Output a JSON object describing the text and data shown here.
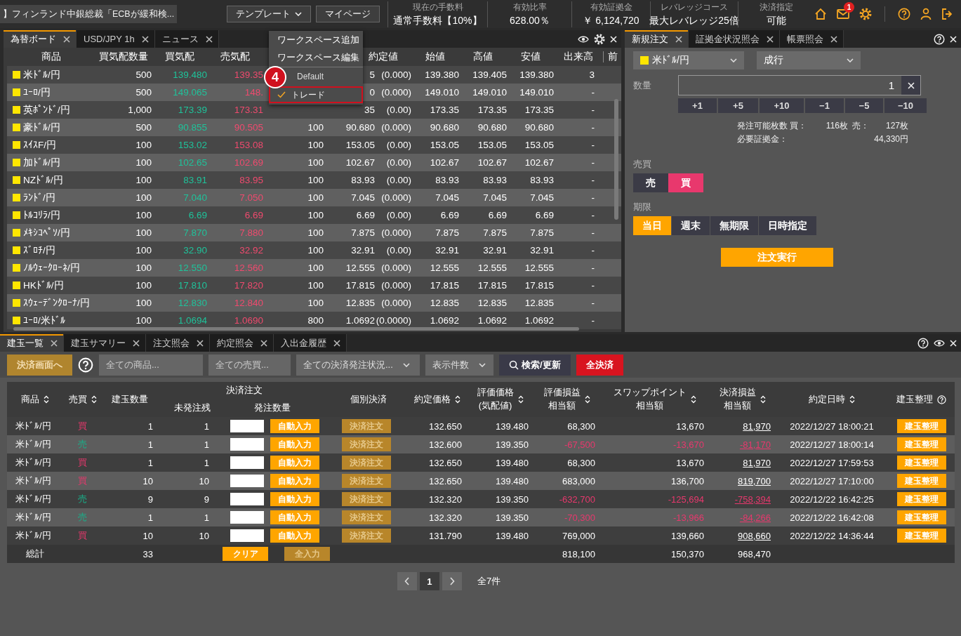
{
  "top_bar": {
    "news": "】フィンランド中銀総裁「ECBが緩和検...",
    "buttons": [
      {
        "label": "テンプレート",
        "dropdown": true
      },
      {
        "label": "マイページ",
        "dropdown": false
      }
    ],
    "stats": [
      {
        "label": "現在の手数料",
        "value": "通常手数料【10%】"
      },
      {
        "label": "有効比率",
        "value": "628.00％"
      },
      {
        "label": "有効証拠金",
        "value": "￥ 6,124,720"
      },
      {
        "label": "レバレッジコース",
        "value": "最大レバレッジ25倍"
      },
      {
        "label": "決済指定",
        "value": "可能"
      }
    ],
    "notification_count": "1"
  },
  "workspace_menu": {
    "items": [
      {
        "kind": "action",
        "label": "ワークスペース追加"
      },
      {
        "kind": "action",
        "label": "ワークスペース編集"
      },
      {
        "kind": "workspace",
        "label": "Default",
        "selected": false,
        "highlighted": false
      },
      {
        "kind": "workspace",
        "label": "トレード",
        "selected": true,
        "highlighted": true
      }
    ],
    "step_marker": "4"
  },
  "rate_board": {
    "tabs": [
      {
        "label": "為替ボード",
        "selected": true
      },
      {
        "label": "USD/JPY 1h",
        "selected": false
      },
      {
        "label": "ニュース",
        "selected": false
      }
    ],
    "columns": [
      "商品",
      "買気配数量",
      "買気配",
      "売気配",
      "約定値",
      "始値",
      "高値",
      "安値",
      "出来高",
      "前"
    ],
    "rows": [
      {
        "product": "米ﾄﾞﾙ/円",
        "bid_qty": "500",
        "bid": "139.480",
        "ask": "139.35",
        "last": "5",
        "change": "(0.000)",
        "open": "139.380",
        "high": "139.405",
        "low": "139.380",
        "volume": "3"
      },
      {
        "product": "ﾕｰﾛ/円",
        "bid_qty": "500",
        "bid": "149.065",
        "ask": "148.",
        "last": "0",
        "change": "(0.000)",
        "open": "149.010",
        "high": "149.010",
        "low": "149.010",
        "volume": "-"
      },
      {
        "product": "英ﾎﾟﾝﾄﾞ/円",
        "bid_qty": "1,000",
        "bid": "173.39",
        "ask": "173.31",
        "last": "35",
        "change": "(0.00)",
        "open": "173.35",
        "high": "173.35",
        "low": "173.35",
        "volume": "-"
      },
      {
        "product": "豪ﾄﾞﾙ/円",
        "bid_qty": "500",
        "bid": "90.855",
        "ask": "90.505",
        "column_5": "100",
        "last": "90.680",
        "change": "(0.000)",
        "open": "90.680",
        "high": "90.680",
        "low": "90.680",
        "volume": "-"
      },
      {
        "product": "ｽｲｽF/円",
        "bid_qty": "100",
        "bid": "153.02",
        "ask": "153.08",
        "column_5": "100",
        "last": "153.05",
        "change": "(0.00)",
        "open": "153.05",
        "high": "153.05",
        "low": "153.05",
        "volume": "-"
      },
      {
        "product": "加ﾄﾞﾙ/円",
        "bid_qty": "100",
        "bid": "102.65",
        "ask": "102.69",
        "column_5": "100",
        "last": "102.67",
        "change": "(0.00)",
        "open": "102.67",
        "high": "102.67",
        "low": "102.67",
        "volume": "-"
      },
      {
        "product": "NZﾄﾞﾙ/円",
        "bid_qty": "100",
        "bid": "83.91",
        "ask": "83.95",
        "column_5": "100",
        "last": "83.93",
        "change": "(0.00)",
        "open": "83.93",
        "high": "83.93",
        "low": "83.93",
        "volume": "-"
      },
      {
        "product": "ﾗﾝﾄﾞ/円",
        "bid_qty": "100",
        "bid": "7.040",
        "ask": "7.050",
        "column_5": "100",
        "last": "7.045",
        "change": "(0.000)",
        "open": "7.045",
        "high": "7.045",
        "low": "7.045",
        "volume": "-"
      },
      {
        "product": "ﾄﾙｺﾘﾗ/円",
        "bid_qty": "100",
        "bid": "6.69",
        "ask": "6.69",
        "column_5": "100",
        "last": "6.69",
        "change": "(0.00)",
        "open": "6.69",
        "high": "6.69",
        "low": "6.69",
        "volume": "-"
      },
      {
        "product": "ﾒｷｼｺﾍﾟｿ/円",
        "bid_qty": "100",
        "bid": "7.870",
        "ask": "7.880",
        "column_5": "100",
        "last": "7.875",
        "change": "(0.000)",
        "open": "7.875",
        "high": "7.875",
        "low": "7.875",
        "volume": "-"
      },
      {
        "product": "ｽﾞﾛﾁ/円",
        "bid_qty": "100",
        "bid": "32.90",
        "ask": "32.92",
        "column_5": "100",
        "last": "32.91",
        "change": "(0.00)",
        "open": "32.91",
        "high": "32.91",
        "low": "32.91",
        "volume": "-"
      },
      {
        "product": "ﾉﾙｳｪｰｸﾛｰﾈ/円",
        "bid_qty": "100",
        "bid": "12.550",
        "ask": "12.560",
        "column_5": "100",
        "last": "12.555",
        "change": "(0.000)",
        "open": "12.555",
        "high": "12.555",
        "low": "12.555",
        "volume": "-"
      },
      {
        "product": "HKﾄﾞﾙ/円",
        "bid_qty": "100",
        "bid": "17.810",
        "ask": "17.820",
        "column_5": "100",
        "last": "17.815",
        "change": "(0.000)",
        "open": "17.815",
        "high": "17.815",
        "low": "17.815",
        "volume": "-"
      },
      {
        "product": "ｽｳｪｰﾃﾞﾝｸﾛｰﾅ/円",
        "bid_qty": "100",
        "bid": "12.830",
        "ask": "12.840",
        "column_5": "100",
        "last": "12.835",
        "change": "(0.000)",
        "open": "12.835",
        "high": "12.835",
        "low": "12.835",
        "volume": "-"
      },
      {
        "product": "ﾕｰﾛ/米ﾄﾞﾙ",
        "bid_qty": "100",
        "bid": "1.0694",
        "ask": "1.0690",
        "column_5": "800",
        "last": "1.0692",
        "change": "(0.0000)",
        "open": "1.0692",
        "high": "1.0692",
        "low": "1.0692",
        "volume": "-"
      }
    ]
  },
  "order_panel": {
    "tabs": [
      {
        "label": "新規注文",
        "selected": true
      },
      {
        "label": "証拠金状況照会",
        "selected": false
      },
      {
        "label": "帳票照会",
        "selected": false
      }
    ],
    "symbol": "米ﾄﾞﾙ/円",
    "order_type": "成行",
    "quantity_label": "数量",
    "quantity": "1",
    "steps": [
      "+1",
      "+5",
      "+10",
      "−1",
      "−5",
      "−10"
    ],
    "available_label": "発注可能枚数 買：",
    "available_buy": "116枚",
    "sell_label": "売：",
    "available_sell": "127枚",
    "margin_label": "必要証拠金：",
    "margin": "44,330円",
    "side_label": "売買",
    "sides": [
      {
        "label": "売",
        "kind": "sell",
        "selected": false
      },
      {
        "label": "買",
        "kind": "buy",
        "selected": true
      }
    ],
    "period_label": "期限",
    "periods": [
      {
        "label": "当日",
        "selected": true
      },
      {
        "label": "週末",
        "selected": false
      },
      {
        "label": "無期限",
        "selected": false
      },
      {
        "label": "日時指定",
        "selected": false
      }
    ],
    "submit": "注文実行"
  },
  "positions_panel": {
    "tabs": [
      {
        "label": "建玉一覧",
        "selected": true
      },
      {
        "label": "建玉サマリー",
        "selected": false
      },
      {
        "label": "注文照会",
        "selected": false
      },
      {
        "label": "約定照会",
        "selected": false
      },
      {
        "label": "入出金履歴",
        "selected": false
      }
    ],
    "toolbar": {
      "settle_screen": {
        "label": "決済画面へ",
        "disabled": true
      },
      "filters": [
        {
          "kind": "field",
          "placeholder": "全ての商品..."
        },
        {
          "kind": "field",
          "placeholder": "全ての売買..."
        },
        {
          "kind": "select",
          "label": "全ての決済発注状況..."
        },
        {
          "kind": "select",
          "label": "表示件数"
        }
      ],
      "search": "検索/更新",
      "close_all": "全決済"
    },
    "columns": [
      {
        "lines": [
          "商品"
        ],
        "sortable": true
      },
      {
        "lines": [
          "売買"
        ],
        "sortable": true
      },
      {
        "lines": [
          "建玉数量"
        ],
        "sortable": false
      },
      {
        "lines": [
          "決済注文"
        ],
        "sortable": false,
        "children": [
          {
            "lines": [
              "未発注残"
            ]
          },
          {
            "lines": [
              "発注数量"
            ]
          }
        ]
      },
      {
        "lines": [
          "個別決済"
        ],
        "sortable": false
      },
      {
        "lines": [
          "約定価格"
        ],
        "sortable": true
      },
      {
        "lines": [
          "評価価格",
          "(気配値)"
        ],
        "sortable": true
      },
      {
        "lines": [
          "評価損益",
          "相当額"
        ],
        "sortable": true
      },
      {
        "lines": [
          "スワップポイント",
          "相当額"
        ],
        "sortable": true
      },
      {
        "lines": [
          "決済損益",
          "相当額"
        ],
        "sortable": true
      },
      {
        "lines": [
          "約定日時"
        ],
        "sortable": true
      },
      {
        "lines": [
          "建玉整理"
        ],
        "sortable": false,
        "help": true
      }
    ],
    "rows": [
      {
        "product": "米ﾄﾞﾙ/円",
        "side": {
          "label": "買",
          "kind": "buy"
        },
        "quantity": "1",
        "unfilled": "1",
        "auto": "自動入力",
        "settle": {
          "label": "決済注文",
          "disabled": true
        },
        "price": "132.650",
        "eval_price": "139.480",
        "pnl": "68,300",
        "swap": "13,670",
        "realized": "81,970",
        "date": "2022/12/27 18:00:21",
        "loss": false,
        "organize": "建玉整理"
      },
      {
        "product": "米ﾄﾞﾙ/円",
        "side": {
          "label": "売",
          "kind": "sell"
        },
        "quantity": "1",
        "unfilled": "1",
        "auto": "自動入力",
        "settle": {
          "label": "決済注文",
          "disabled": true
        },
        "price": "132.600",
        "eval_price": "139.350",
        "pnl": "-67,500",
        "swap": "-13,670",
        "realized": "-81,170",
        "date": "2022/12/27 18:00:14",
        "loss": true,
        "organize": "建玉整理"
      },
      {
        "product": "米ﾄﾞﾙ/円",
        "side": {
          "label": "買",
          "kind": "buy"
        },
        "quantity": "1",
        "unfilled": "1",
        "auto": "自動入力",
        "settle": {
          "label": "決済注文",
          "disabled": true
        },
        "price": "132.650",
        "eval_price": "139.480",
        "pnl": "68,300",
        "swap": "13,670",
        "realized": "81,970",
        "date": "2022/12/27 17:59:53",
        "loss": false,
        "organize": "建玉整理"
      },
      {
        "product": "米ﾄﾞﾙ/円",
        "side": {
          "label": "買",
          "kind": "buy"
        },
        "quantity": "10",
        "unfilled": "10",
        "auto": "自動入力",
        "settle": {
          "label": "決済注文",
          "disabled": true
        },
        "price": "132.650",
        "eval_price": "139.480",
        "pnl": "683,000",
        "swap": "136,700",
        "realized": "819,700",
        "date": "2022/12/27 17:10:00",
        "loss": false,
        "organize": "建玉整理"
      },
      {
        "product": "米ﾄﾞﾙ/円",
        "side": {
          "label": "売",
          "kind": "sell"
        },
        "quantity": "9",
        "unfilled": "9",
        "auto": "自動入力",
        "settle": {
          "label": "決済注文",
          "disabled": true
        },
        "price": "132.320",
        "eval_price": "139.350",
        "pnl": "-632,700",
        "swap": "-125,694",
        "realized": "-758,394",
        "date": "2022/12/22 16:42:25",
        "loss": true,
        "organize": "建玉整理"
      },
      {
        "product": "米ﾄﾞﾙ/円",
        "side": {
          "label": "売",
          "kind": "sell"
        },
        "quantity": "1",
        "unfilled": "1",
        "auto": "自動入力",
        "settle": {
          "label": "決済注文",
          "disabled": true
        },
        "price": "132.320",
        "eval_price": "139.350",
        "pnl": "-70,300",
        "swap": "-13,966",
        "realized": "-84,266",
        "date": "2022/12/22 16:42:08",
        "loss": true,
        "organize": "建玉整理"
      },
      {
        "product": "米ﾄﾞﾙ/円",
        "side": {
          "label": "買",
          "kind": "buy"
        },
        "quantity": "10",
        "unfilled": "10",
        "auto": "自動入力",
        "settle": {
          "label": "決済注文",
          "disabled": true
        },
        "price": "131.790",
        "eval_price": "139.480",
        "pnl": "769,000",
        "swap": "139,660",
        "realized": "908,660",
        "date": "2022/12/22 14:36:44",
        "loss": false,
        "organize": "建玉整理"
      }
    ],
    "total": {
      "label": "総計",
      "quantity": "33",
      "clear": "クリア",
      "fill_all": {
        "label": "全入力",
        "disabled": true
      },
      "pnl": "818,100",
      "swap": "150,370",
      "realized": "968,470"
    },
    "pagination": {
      "pages": [
        {
          "label": "1",
          "selected": true
        }
      ],
      "total": "全7件"
    }
  }
}
